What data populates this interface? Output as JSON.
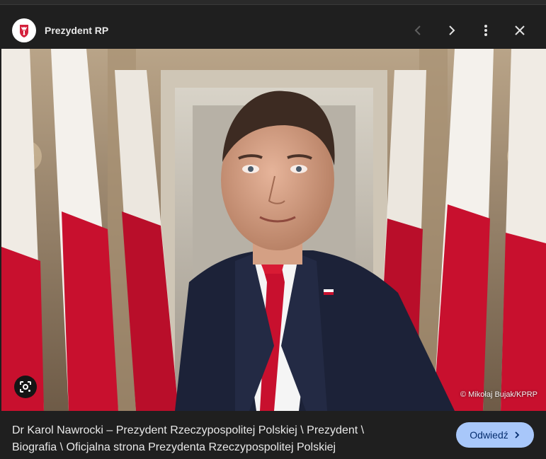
{
  "header": {
    "site_name": "Prezydent RP",
    "logo_icon": "polish-eagle-emblem-icon",
    "actions": [
      "chevron-left-icon",
      "chevron-right-icon",
      "more-vert-icon",
      "close-icon"
    ]
  },
  "viewer": {
    "credit": "© Mikołaj Bujak/KPRP",
    "lens_icon": "google-lens-icon",
    "colors": {
      "flag_red": "#c8102e",
      "flag_white": "#f4f1ec",
      "suit": "#1c2238",
      "tie": "#c8102e"
    }
  },
  "footer": {
    "caption_line1": "Dr Karol Nawrocki – Prezydent Rzeczypospolitej Polskiej \\ Prezydent \\",
    "caption_line2": "Biografia \\ Oficjalna strona Prezydenta Rzeczypospolitej Polskiej",
    "visit_label": "Odwiedź",
    "visit_icon": "chevron-right-icon",
    "visit_color": "#a8c7fa"
  }
}
